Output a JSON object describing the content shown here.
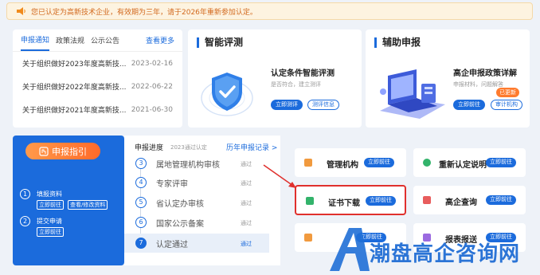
{
  "notice": {
    "text": "您已认定为高新技术企业，有效期为三年，请于2026年重新参加认定。"
  },
  "news": {
    "tabs": [
      "申报通知",
      "政策法规",
      "公示公告"
    ],
    "more": "查看更多",
    "items": [
      {
        "title": "关于组织做好2023年度高新技...",
        "date": "2023-02-16"
      },
      {
        "title": "关于组织做好2022年度高新技...",
        "date": "2022-06-22"
      },
      {
        "title": "关于组织做好2021年度高新技...",
        "date": "2021-06-30"
      }
    ]
  },
  "eval": {
    "title": "智能评测",
    "sub_title": "认定条件智能评测",
    "sub_desc": "是否符合，建立测评",
    "btn_primary": "立即测评",
    "btn_secondary": "测评信息"
  },
  "aux": {
    "title": "辅助申报",
    "sub_title": "高企申报政策详解",
    "sub_desc": "申报材料，问题解答",
    "badge": "已更新",
    "btn_primary": "立即前往",
    "btn_secondary": "审计机构"
  },
  "guide": {
    "button": "申报指引",
    "steps": [
      {
        "num": "1",
        "label": "填报资料",
        "buttons": [
          "立即前往",
          "查看/修改资料"
        ]
      },
      {
        "num": "2",
        "label": "提交申请",
        "buttons": [
          "立即前往"
        ]
      }
    ]
  },
  "progress": {
    "title": "申报进度",
    "year": "2023通过认定",
    "history_link": "历年申报记录 >",
    "steps": [
      {
        "num": "3",
        "name": "属地管理机构审核",
        "status": "通过"
      },
      {
        "num": "4",
        "name": "专家评审",
        "status": "通过"
      },
      {
        "num": "5",
        "name": "省认定办审核",
        "status": "通过"
      },
      {
        "num": "6",
        "name": "国家公示备案",
        "status": "通过"
      },
      {
        "num": "7",
        "name": "认定通过",
        "status": "通过"
      }
    ]
  },
  "tiles": [
    {
      "label": "管理机构",
      "btn": "立即前往",
      "color": "#f19a3e"
    },
    {
      "label": "重新认定说明",
      "btn": "立即前往",
      "color": "#33b36b"
    },
    {
      "label": "证书下载",
      "btn": "立即前往",
      "color": "#33b36b"
    },
    {
      "label": "高企查询",
      "btn": "立即前往",
      "color": "#e85d5d"
    },
    {
      "label": "",
      "btn": "立即前往",
      "color": "#f19a3e"
    },
    {
      "label": "报表报送",
      "btn": "立即前往",
      "color": "#9b6ae0"
    }
  ],
  "watermark": {
    "text": "潮盘高企咨询网"
  },
  "colors": {
    "accent": "#1b6bdc",
    "highlight": "#e0302d",
    "orange": "#ff7b2e"
  }
}
